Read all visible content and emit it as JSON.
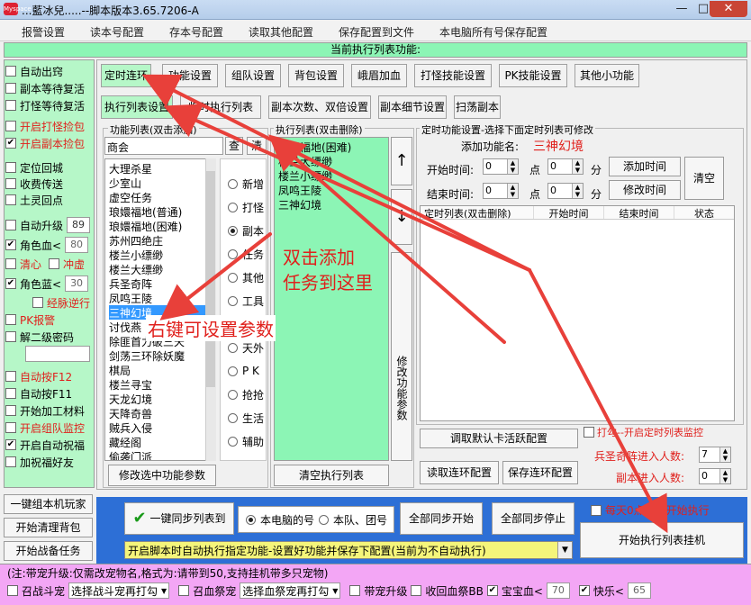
{
  "window": {
    "title": "...藍冰兒.....--脚本版本3.65.7206-A",
    "icon_text": "Myspace",
    "min": "—",
    "max": "□",
    "close": "✕"
  },
  "menu": [
    "报警设置",
    "读本号配置",
    "存本号配置",
    "读取其他配置",
    "保存配置到文件",
    "本电脑所有号保存配置"
  ],
  "status_bar": "当前执行列表功能:",
  "left_panel": {
    "items": [
      {
        "label": "自动出窍",
        "checked": false,
        "red": false
      },
      {
        "label": "副本等待复活",
        "checked": false,
        "red": false
      },
      {
        "label": "打怪等待复活",
        "checked": false,
        "red": false
      },
      {
        "label": "开启打怪捡包",
        "checked": false,
        "red": true
      },
      {
        "label": "开启副本捡包",
        "checked": true,
        "red": true
      },
      {
        "label": "定位回城",
        "checked": false,
        "red": false
      },
      {
        "label": "收费传送",
        "checked": false,
        "red": false
      },
      {
        "label": "土灵回点",
        "checked": false,
        "red": false
      }
    ],
    "auto_upgrade": {
      "label": "自动升级",
      "value": "89"
    },
    "role_hp": {
      "label": "角色血<",
      "value": "80"
    },
    "qingxin": "清心",
    "chongxu": "冲虚",
    "role_mp": {
      "label": "角色蓝<",
      "value": "30"
    },
    "jingmai": "经脉逆行",
    "items2": [
      {
        "label": "PK报警",
        "checked": false,
        "red": true
      },
      {
        "label": "解二级密码",
        "checked": false,
        "red": false
      }
    ],
    "items3": [
      {
        "label": "自动按F12",
        "checked": false,
        "red": true
      },
      {
        "label": "自动按F11",
        "checked": false,
        "red": false
      },
      {
        "label": "开始加工材料",
        "checked": false,
        "red": false
      },
      {
        "label": "开启组队监控",
        "checked": false,
        "red": true
      },
      {
        "label": "开启自动祝福",
        "checked": true,
        "red": false
      },
      {
        "label": "加祝福好友",
        "checked": false,
        "red": false
      }
    ],
    "buttons": [
      "一键组本机玩家",
      "开始清理背包",
      "开始战备任务"
    ]
  },
  "tabs1": [
    "定时连环",
    "功能设置",
    "组队设置",
    "背包设置",
    "峨眉加血",
    "打怪技能设置",
    "PK技能设置",
    "其他小功能"
  ],
  "tabs2": [
    "执行列表设置",
    "临时执行列表",
    "副本次数、双倍设置",
    "副本细节设置",
    "扫荡副本"
  ],
  "func_list": {
    "title": "功能列表(双击添加)",
    "search_value": "商会",
    "search_btn": "查",
    "clear_btn": "清",
    "items": [
      "大理杀星",
      "少室山",
      "虚空任务",
      "琅嬛福地(普通)",
      "琅嬛福地(困难)",
      "苏州四绝庄",
      "楼兰小缥缈",
      "楼兰大缥缈",
      "兵圣奇阵",
      "凤鸣王陵",
      "三神幻境",
      "讨伐燕",
      "除匪首力破三天",
      "剑荡三环除妖魔",
      "棋局",
      "楼兰寻宝",
      "天龙幻境",
      "天降奇兽",
      "贼兵入侵",
      "藏经阁",
      "偷袭门派"
    ],
    "selected_index": 10,
    "modify_btn": "修改选中功能参数"
  },
  "categories": [
    {
      "label": "新增",
      "on": false
    },
    {
      "label": "打怪",
      "on": false
    },
    {
      "label": "副本",
      "on": true
    },
    {
      "label": "任务",
      "on": false
    },
    {
      "label": "其他",
      "on": false
    },
    {
      "label": "工具",
      "on": false
    },
    {
      "label": "定时",
      "on": false
    },
    {
      "label": "天外",
      "on": false
    },
    {
      "label": "P K",
      "on": false
    },
    {
      "label": "抢抢",
      "on": false
    },
    {
      "label": "生活",
      "on": false
    },
    {
      "label": "辅助",
      "on": false
    }
  ],
  "exec_list": {
    "title": "执行列表(双击删除)",
    "items": [
      "琅嬛福地(困难)",
      "楼兰大缥缈",
      "楼兰小缥缈",
      "凤鸣王陵",
      "三神幻境"
    ],
    "up": "↑",
    "down": "↓",
    "modify_params": "修改功能参数",
    "clear_btn": "清空执行列表"
  },
  "timed": {
    "title": "定时功能设置-选择下面定时列表可修改",
    "add_label": "添加功能名:",
    "add_value": "三神幻境",
    "start_label": "开始时间:",
    "end_label": "结束时间:",
    "start_h": "0",
    "start_m": "0",
    "end_h": "0",
    "end_m": "0",
    "point": "点",
    "minute": "分",
    "add_btn": "添加时间",
    "modify_btn": "修改时间",
    "clear_btn": "清空",
    "table_headers": [
      "定时列表(双击删除)",
      "开始时间",
      "结束时间",
      "状态"
    ],
    "read_default": "调取默认卡活跃配置",
    "read_cycle": "读取连环配置",
    "save_cycle": "保存连环配置",
    "monitor": "打勾--开启定时列表监控",
    "bingsheng_label": "兵圣奇阵进入人数:",
    "bingsheng_value": "7",
    "fuben_label": "副本进入人数:",
    "fuben_value": "0"
  },
  "bottom": {
    "sync_btn": "一键同步列表到",
    "radio_pc": "本电脑的号",
    "radio_team": "本队、团号",
    "sync_start": "全部同步开始",
    "sync_stop": "全部同步停止",
    "daily_reset": "每天0点重新开始执行",
    "start_exec": "开始执行列表挂机",
    "dropdown": "开启脚本时自动执行指定功能-设置好功能并保存下配置(当前为不自动执行)"
  },
  "pink": {
    "note": "(注:带宠升级:仅需改宠物名,格式为:请带到50,支持挂机带多只宠物)",
    "zhaohuo_label": "召战斗宠",
    "zhaohuo_select": "选择战斗宠再打勾",
    "xuechong_label": "召血祭宠",
    "xuechong_select": "选择血祭宠再打勾",
    "daichong": "带宠升级",
    "shouhui": "收回血祭BB",
    "baobao_label": "宝宝血<",
    "baobao_value": "70",
    "kuaile_label": "快乐<",
    "kuaile_value": "65"
  },
  "annotations": {
    "double_click": "双击添加\n任务到这里",
    "right_click": "右键可设置参数"
  }
}
